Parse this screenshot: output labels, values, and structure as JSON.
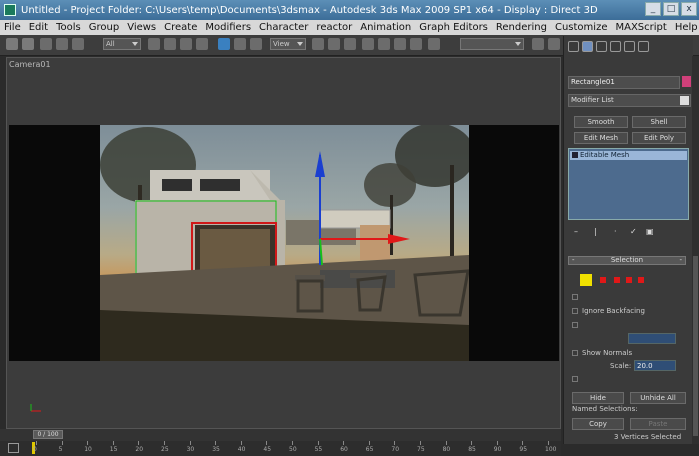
{
  "window": {
    "title": "Untitled  - Project Folder: C:\\Users\\temp\\Documents\\3dsmax  - Autodesk 3ds Max  2009 SP1  x64  - Display : Direct 3D",
    "controls": [
      "_",
      "□",
      "x"
    ]
  },
  "menu": [
    "File",
    "Edit",
    "Tools",
    "Group",
    "Views",
    "Create",
    "Modifiers",
    "Character",
    "reactor",
    "Animation",
    "Graph Editors",
    "Rendering",
    "Customize",
    "MAXScript",
    "Help"
  ],
  "toolbar": {
    "selection_filter": "All",
    "ref_coord": "View"
  },
  "viewport": {
    "label": "Camera01"
  },
  "command_panel": {
    "object_name": "Rectangle01",
    "object_color": "#d0407a",
    "modifier_list": "Modifier List",
    "buttons": {
      "smooth": "Smooth",
      "shell": "Shell",
      "edit_mesh": "Edit Mesh",
      "edit_poly": "Edit Poly"
    },
    "stack": [
      "Editable Mesh"
    ],
    "selection": {
      "title": "Selection",
      "ignore_backfacing": "Ignore Backfacing",
      "show_normals": "Show Normals",
      "scale_label": "Scale:",
      "scale_value": "20.0",
      "hide": "Hide",
      "unhide_all": "Unhide All",
      "named_selections": "Named Selections:",
      "copy": "Copy",
      "paste": "Paste",
      "status": "3 Vertices Selected"
    }
  },
  "timeline": {
    "frame": "0 / 100",
    "ticks": [
      "0",
      "5",
      "10",
      "15",
      "20",
      "25",
      "30",
      "35",
      "40",
      "45",
      "50",
      "55",
      "60",
      "65",
      "70",
      "75",
      "80",
      "85",
      "90",
      "95",
      "100"
    ]
  },
  "colors": {
    "selected_vertex_mode": "#f0e000",
    "transform_z_axis": "#1a3fd0",
    "transform_x_axis": "#e01818",
    "transform_y_axis": "#18c018"
  }
}
